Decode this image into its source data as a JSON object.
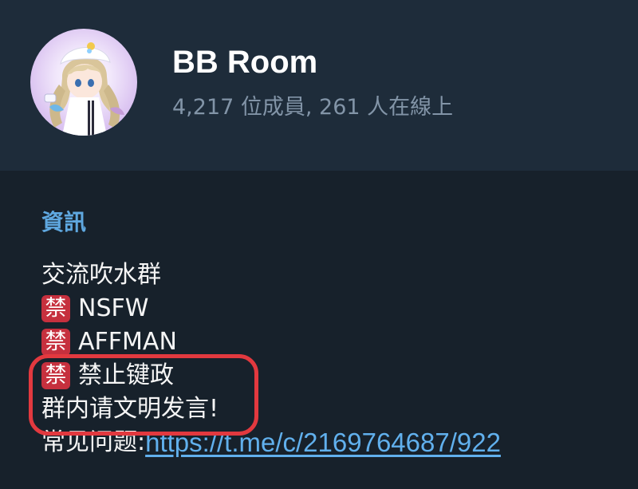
{
  "group": {
    "name": "BB Room",
    "members": "4,217 位成員, 261 人在線上"
  },
  "info": {
    "title": "資訊",
    "lines": {
      "intro": "交流吹水群",
      "rule1_icon": "禁",
      "rule1": "NSFW",
      "rule2_icon": "禁",
      "rule2": "AFFMAN",
      "rule3_icon": "禁",
      "rule3": "禁止键政",
      "civil": "群内请文明发言!",
      "faq_label": "常见问题:",
      "faq_link": "https://t.me/c/2169764687/922"
    }
  },
  "colors": {
    "background": "#17212b",
    "header": "#1e2c3a",
    "accent": "#5fa8e0",
    "link": "#61b0ed",
    "ban_badge": "#c6303e",
    "highlight": "#e2393f"
  },
  "icons": {
    "avatar": "anime-girl-avatar",
    "ban": "prohibited-emoji"
  }
}
